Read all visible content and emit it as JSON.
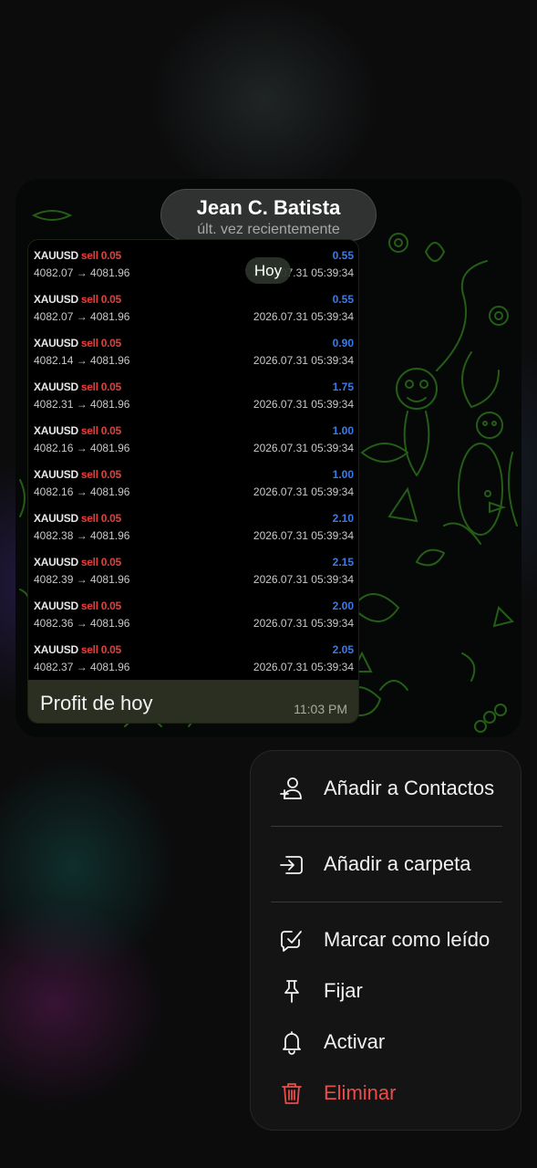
{
  "chat_header": {
    "name": "Jean C. Batista",
    "status": "últ. vez recientemente"
  },
  "date_chip": "Hoy",
  "trades": [
    {
      "symbol": "XAUUSD",
      "side": "sell 0.05",
      "profit": "0.55",
      "prices": "4082.07 → 4081.96",
      "time": "2026.07.31 05:39:34"
    },
    {
      "symbol": "XAUUSD",
      "side": "sell 0.05",
      "profit": "0.55",
      "prices": "4082.07 → 4081.96",
      "time": "2026.07.31 05:39:34"
    },
    {
      "symbol": "XAUUSD",
      "side": "sell 0.05",
      "profit": "0.90",
      "prices": "4082.14 → 4081.96",
      "time": "2026.07.31 05:39:34"
    },
    {
      "symbol": "XAUUSD",
      "side": "sell 0.05",
      "profit": "1.75",
      "prices": "4082.31 → 4081.96",
      "time": "2026.07.31 05:39:34"
    },
    {
      "symbol": "XAUUSD",
      "side": "sell 0.05",
      "profit": "1.00",
      "prices": "4082.16 → 4081.96",
      "time": "2026.07.31 05:39:34"
    },
    {
      "symbol": "XAUUSD",
      "side": "sell 0.05",
      "profit": "1.00",
      "prices": "4082.16 → 4081.96",
      "time": "2026.07.31 05:39:34"
    },
    {
      "symbol": "XAUUSD",
      "side": "sell 0.05",
      "profit": "2.10",
      "prices": "4082.38 → 4081.96",
      "time": "2026.07.31 05:39:34"
    },
    {
      "symbol": "XAUUSD",
      "side": "sell 0.05",
      "profit": "2.15",
      "prices": "4082.39 → 4081.96",
      "time": "2026.07.31 05:39:34"
    },
    {
      "symbol": "XAUUSD",
      "side": "sell 0.05",
      "profit": "2.00",
      "prices": "4082.36 → 4081.96",
      "time": "2026.07.31 05:39:34"
    },
    {
      "symbol": "XAUUSD",
      "side": "sell 0.05",
      "profit": "2.05",
      "prices": "4082.37 → 4081.96",
      "time": "2026.07.31 05:39:34"
    }
  ],
  "message": {
    "caption": "Profit de hoy",
    "time": "11:03 PM"
  },
  "menu": {
    "items": [
      {
        "label": "Añadir a Contactos",
        "icon": "add-contact-icon"
      },
      {
        "label": "Añadir a carpeta",
        "icon": "folder-add-icon"
      },
      {
        "label": "Marcar como leído",
        "icon": "mark-read-icon"
      },
      {
        "label": "Fijar",
        "icon": "pin-icon"
      },
      {
        "label": "Activar",
        "icon": "bell-icon"
      },
      {
        "label": "Eliminar",
        "icon": "trash-icon"
      }
    ]
  },
  "colors": {
    "sell": "#e0413d",
    "profit": "#3a7be6",
    "danger": "#e84d4a",
    "doodle": "#2f7a1e"
  }
}
